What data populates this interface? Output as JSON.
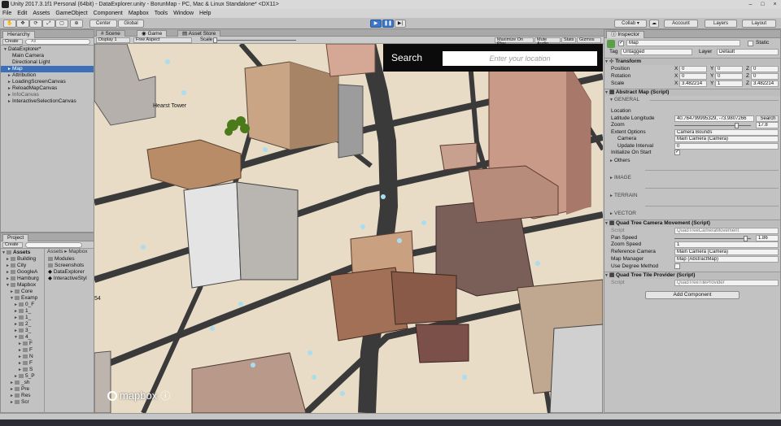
{
  "window": {
    "title": "Unity 2017.3.1f1 Personal (64bit) - DataExplorer.unity - BorunMap - PC, Mac & Linux Standalone* <DX11>",
    "controls": [
      "–",
      "□",
      "×"
    ]
  },
  "menu": [
    "File",
    "Edit",
    "Assets",
    "GameObject",
    "Component",
    "Mapbox",
    "Tools",
    "Window",
    "Help"
  ],
  "toolbar": {
    "pivot": "Center",
    "space": "Global",
    "collab": "Collab ▾",
    "account": "Account",
    "layers": "Layers",
    "layout": "Layout"
  },
  "hierarchy": {
    "tab": "Hierarchy",
    "create": "Create",
    "search_placeholder": "All",
    "scene": "DataExplorer*",
    "items": [
      {
        "label": "Main Camera",
        "expandable": false
      },
      {
        "label": "Directional Light",
        "expandable": false
      },
      {
        "label": "Map",
        "expandable": true,
        "selected": true
      },
      {
        "label": "Attribution",
        "expandable": true
      },
      {
        "label": "LoadingScreenCanvas",
        "expandable": true
      },
      {
        "label": "ReloadMapCanvas",
        "expandable": true
      },
      {
        "label": "InfoCanvas",
        "expandable": true
      },
      {
        "label": "InteractiveSelectionCanvas",
        "expandable": true
      }
    ]
  },
  "project": {
    "tab": "Project",
    "create": "Create",
    "tree": [
      {
        "label": "Assets",
        "bold": true
      },
      {
        "label": "Building"
      },
      {
        "label": "City"
      },
      {
        "label": "GoogleA"
      },
      {
        "label": "Hamburg"
      },
      {
        "label": "Mapbox",
        "bold": true
      },
      {
        "label": "Core"
      },
      {
        "label": "Examp"
      },
      {
        "label": "0_F"
      },
      {
        "label": "1_"
      },
      {
        "label": "1_"
      },
      {
        "label": "2_"
      },
      {
        "label": "3_"
      },
      {
        "label": "4_"
      },
      {
        "label": "F"
      },
      {
        "label": "F"
      },
      {
        "label": "N"
      },
      {
        "label": "F"
      },
      {
        "label": "S"
      },
      {
        "label": "5_P"
      },
      {
        "label": "_sh"
      },
      {
        "label": "Pre"
      },
      {
        "label": "Res"
      },
      {
        "label": "Scr"
      }
    ],
    "breadcrumb": "Assets ▸ Mapbox",
    "files": [
      "Modules",
      "Screenshots",
      "DataExplorer",
      "InteractiveStyl"
    ]
  },
  "scene_tabs": [
    {
      "label": "Scene",
      "active": false
    },
    {
      "label": "Game",
      "active": true
    },
    {
      "label": "Asset Store",
      "active": false
    }
  ],
  "game_toolbar": {
    "display": "Display 1",
    "aspect": "Free Aspect",
    "scale_label": "Scale",
    "buttons": [
      "Maximize On Play",
      "Mute Audio",
      "Stats",
      "Gizmos"
    ]
  },
  "game_view": {
    "search_label": "Search",
    "search_placeholder": "Enter your location",
    "poi_label": "Hearst Tower",
    "attribution": "mapbox",
    "info": "ⓘ",
    "edge_number": "54"
  },
  "inspector": {
    "tab": "Inspector",
    "object_name": "Map",
    "static_label": "Static",
    "tag_label": "Tag",
    "tag_value": "Untagged",
    "layer_label": "Layer",
    "layer_value": "Default",
    "transform": {
      "title": "Transform",
      "rows": [
        {
          "label": "Position",
          "x": "0",
          "y": "0",
          "z": "0"
        },
        {
          "label": "Rotation",
          "x": "0",
          "y": "0",
          "z": "0"
        },
        {
          "label": "Scale",
          "x": "3.482214",
          "y": "1",
          "z": "3.482214"
        }
      ]
    },
    "abstract_map": {
      "title": "Abstract Map (Script)",
      "general": "GENERAL",
      "location_label": "Location",
      "latlon_label": "Latitude Longitude",
      "latlon_value": "40.764799995329, -73.9807266",
      "search_button": "Search",
      "zoom_label": "Zoom",
      "zoom_value": "17.8",
      "zoom_fraction": 0.81,
      "extent_label": "Extent Options",
      "extent_value": "Camera Bounds",
      "camera_label": "Camera",
      "camera_value": "Main Camera (Camera)",
      "update_label": "Update Interval",
      "update_value": "0",
      "init_label": "Initialize On Start",
      "others": "Others",
      "image": "IMAGE",
      "terrain": "TERRAIN",
      "vector": "VECTOR"
    },
    "quadtree_movement": {
      "title": "Quad Tree Camera Movement (Script)",
      "script_label": "Script",
      "script_value": "QuadTreeCameraMovement",
      "pan_label": "Pan Speed",
      "pan_value": "1.86",
      "pan_fraction": 0.93,
      "zoom_speed_label": "Zoom Speed",
      "zoom_speed_value": "1",
      "ref_camera_label": "Reference Camera",
      "ref_camera_value": "Main Camera (Camera)",
      "map_manager_label": "Map Manager",
      "map_manager_value": "Map (AbstractMap)",
      "degree_label": "Use Degree Method"
    },
    "quadtree_provider": {
      "title": "Quad Tree Tile Provider (Script)",
      "script_label": "Script",
      "script_value": "QuadTreeTileProvider"
    },
    "add_component": "Add Component"
  },
  "colors": {
    "selection": "#3d6fb8",
    "road": "#3a3a3a",
    "ground": "#e8dcc6",
    "play_active": "#3c77c8"
  }
}
